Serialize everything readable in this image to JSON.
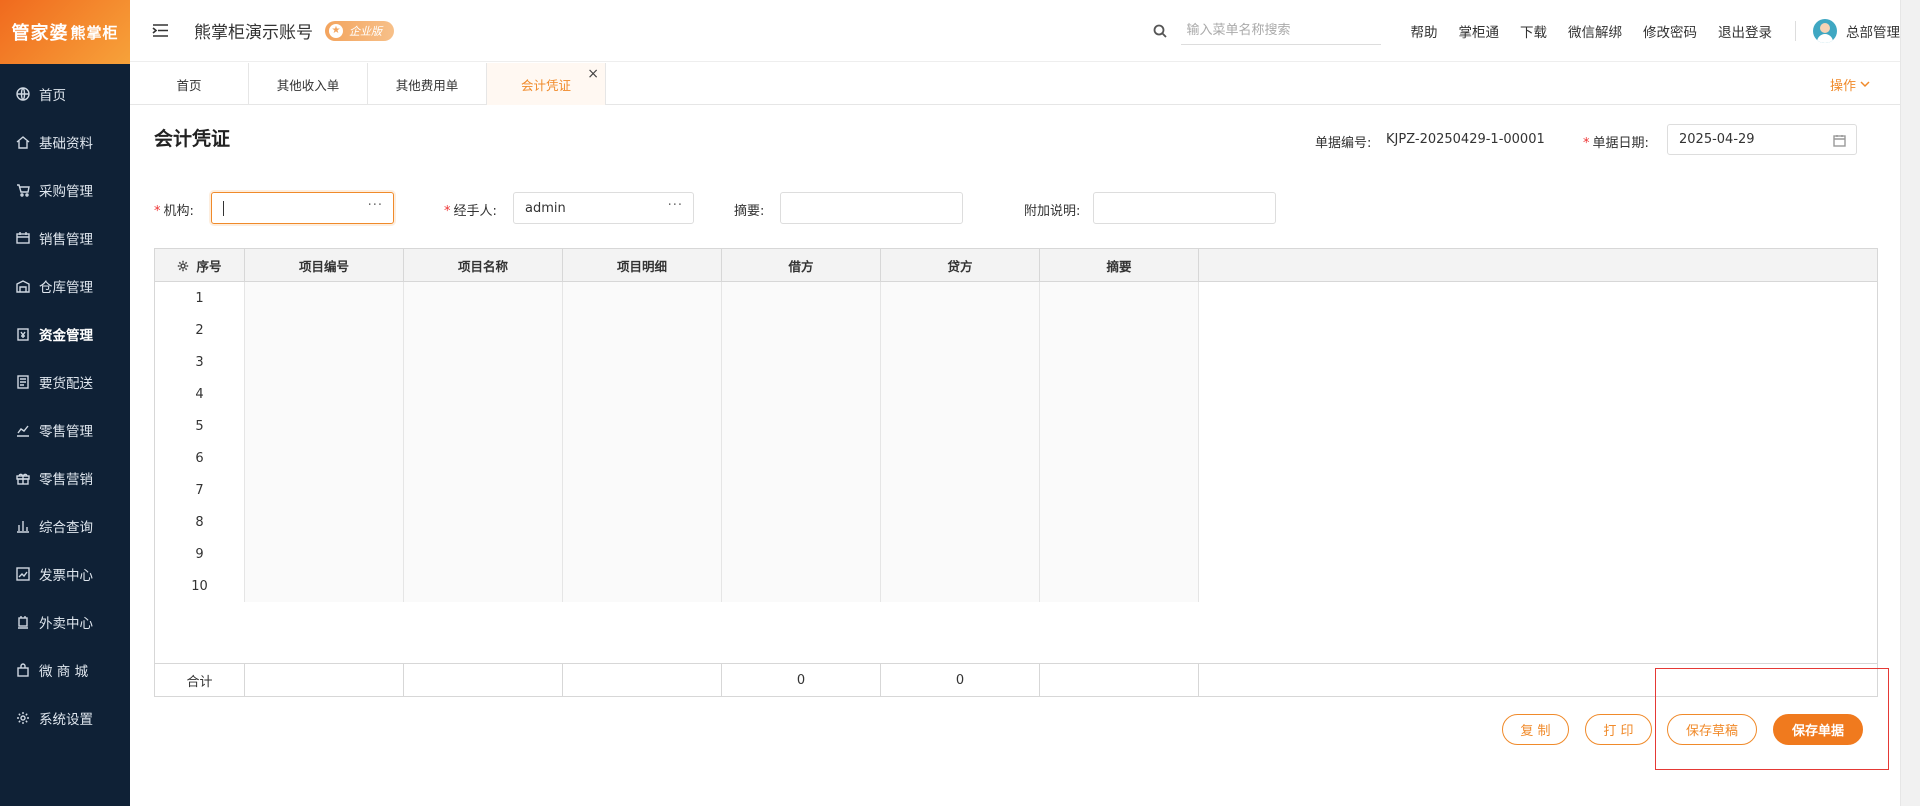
{
  "brand": {
    "logo_text": "管家婆",
    "logo_sub": "熊掌柜"
  },
  "sidebar": {
    "items": [
      {
        "label": "首页",
        "icon": "globe-icon"
      },
      {
        "label": "基础资料",
        "icon": "home-icon"
      },
      {
        "label": "采购管理",
        "icon": "cart-icon"
      },
      {
        "label": "销售管理",
        "icon": "sales-icon"
      },
      {
        "label": "仓库管理",
        "icon": "warehouse-icon"
      },
      {
        "label": "资金管理",
        "icon": "money-icon"
      },
      {
        "label": "要货配送",
        "icon": "document-icon"
      },
      {
        "label": "零售管理",
        "icon": "chart-icon"
      },
      {
        "label": "零售营销",
        "icon": "gift-icon"
      },
      {
        "label": "综合查询",
        "icon": "bar-chart-icon"
      },
      {
        "label": "发票中心",
        "icon": "trend-icon"
      },
      {
        "label": "外卖中心",
        "icon": "delivery-icon"
      },
      {
        "label": "微 商 城",
        "icon": "bag-icon"
      },
      {
        "label": "系统设置",
        "icon": "gear-icon"
      }
    ],
    "active_index": 5
  },
  "header": {
    "account_title": "熊掌柜演示账号",
    "badge": "企业版",
    "search_placeholder": "输入菜单名称搜索",
    "links": [
      "帮助",
      "掌柜通",
      "下载",
      "微信解绑",
      "修改密码",
      "退出登录"
    ],
    "user_name": "总部管理"
  },
  "tabs": {
    "items": [
      "首页",
      "其他收入单",
      "其他费用单",
      "会计凭证"
    ],
    "active_index": 3,
    "ops_label": "操作"
  },
  "voucher": {
    "title": "会计凭证",
    "doc_no_label": "单据编号:",
    "doc_no": "KJPZ-20250429-1-00001",
    "doc_date_label": "单据日期:",
    "doc_date": "2025-04-29"
  },
  "form": {
    "org_label": "机构:",
    "org_value": "",
    "handler_label": "经手人:",
    "handler_value": "admin",
    "summary_label": "摘要:",
    "summary_value": "",
    "note_label": "附加说明:",
    "note_value": ""
  },
  "table": {
    "columns": [
      "序号",
      "项目编号",
      "项目名称",
      "项目明细",
      "借方",
      "贷方",
      "摘要"
    ],
    "rows": [
      "1",
      "2",
      "3",
      "4",
      "5",
      "6",
      "7",
      "8",
      "9",
      "10"
    ],
    "footer": {
      "label": "合计",
      "debit_total": "0",
      "credit_total": "0"
    }
  },
  "actions": {
    "copy": "复 制",
    "print": "打 印",
    "save_draft": "保存草稿",
    "save_doc": "保存单据"
  },
  "colors": {
    "accent": "#f07a1e",
    "sidebar_bg": "#0f2136",
    "highlight": "#e53935"
  }
}
